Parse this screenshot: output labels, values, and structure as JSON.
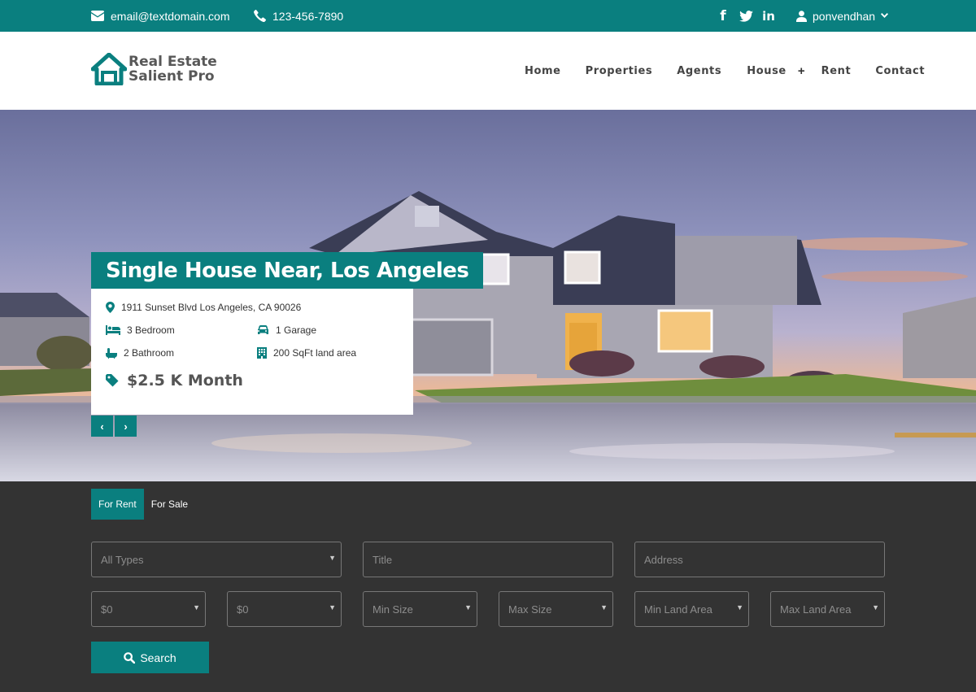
{
  "topbar": {
    "email": "email@textdomain.com",
    "phone": "123-456-7890",
    "social": [
      "f",
      "t",
      "in"
    ],
    "user": "ponvendhan"
  },
  "header": {
    "logo_line1": "Real Estate",
    "logo_line2": "Salient Pro",
    "nav": [
      "Home",
      "Properties",
      "Agents",
      "House",
      "Rent",
      "Contact"
    ],
    "house_plus": "+"
  },
  "hero": {
    "title": "Single House Near, Los Angeles",
    "address": "1911 Sunset Blvd Los Angeles, CA 90026",
    "bedrooms": "3 Bedroom",
    "garage": "1 Garage",
    "bathrooms": "2 Bathroom",
    "land_area": "200 SqFt land area",
    "price": "$2.5 K Month",
    "prev": "‹",
    "next": "›"
  },
  "search": {
    "tabs": [
      "For Rent",
      "For Sale"
    ],
    "type_select": "All Types",
    "title_placeholder": "Title",
    "address_placeholder": "Address",
    "min_price": "$0",
    "max_price": "$0",
    "min_size": "Min Size",
    "max_size": "Max Size",
    "min_land": "Min Land Area",
    "max_land": "Max Land Area",
    "button": "Search"
  },
  "colors": {
    "accent": "#0a7f7f",
    "panel": "#333333"
  }
}
